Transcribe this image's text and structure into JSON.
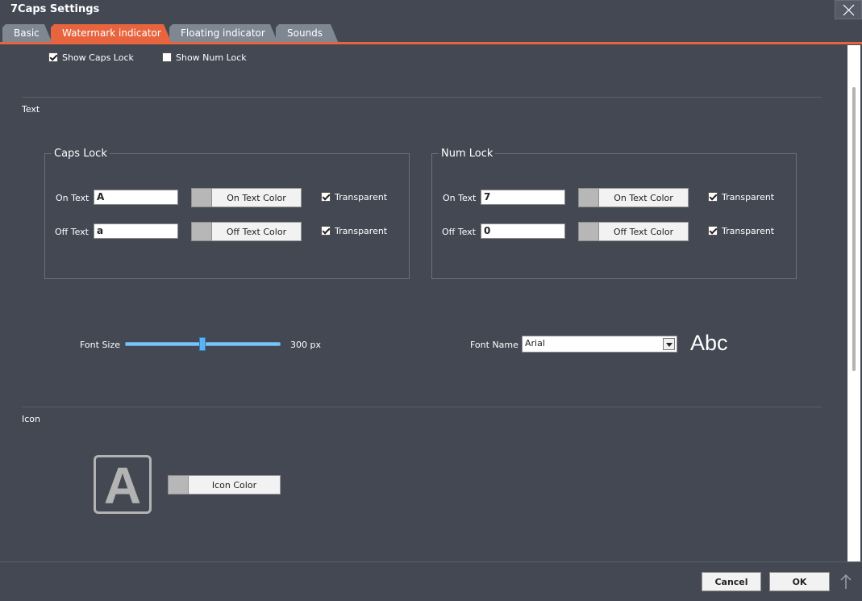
{
  "window": {
    "title": "7Caps Settings"
  },
  "tabs": [
    {
      "label": "Basic"
    },
    {
      "label": "Watermark indicator"
    },
    {
      "label": "Floating indicator"
    },
    {
      "label": "Sounds"
    }
  ],
  "top_options": {
    "show_caps_lock": {
      "label": "Show Caps Lock",
      "checked": true
    },
    "show_num_lock": {
      "label": "Show Num Lock",
      "checked": false
    }
  },
  "text_section": {
    "header": "Text",
    "caps_lock": {
      "title": "Caps Lock",
      "on_text_label": "On Text",
      "on_text_value": "A",
      "on_color_label": "On Text Color",
      "on_transparent_label": "Transparent",
      "off_text_label": "Off Text",
      "off_text_value": "a",
      "off_color_label": "Off Text Color",
      "off_transparent_label": "Transparent"
    },
    "num_lock": {
      "title": "Num Lock",
      "on_text_label": "On Text",
      "on_text_value": "7",
      "on_color_label": "On Text Color",
      "on_transparent_label": "Transparent",
      "off_text_label": "Off Text",
      "off_text_value": "0",
      "off_color_label": "Off Text Color",
      "off_transparent_label": "Transparent"
    },
    "font_size_label": "Font Size",
    "font_size_value": "300 px",
    "font_size_slider_fraction": 0.49,
    "font_name_label": "Font Name",
    "font_name_value": "Arial",
    "font_preview": "Abc"
  },
  "icon_section": {
    "header": "Icon",
    "icon_letter": "A",
    "icon_color_label": "Icon Color"
  },
  "footer": {
    "cancel_label": "Cancel",
    "ok_label": "OK"
  },
  "colors": {
    "accent": "#e8643e",
    "background": "#434853",
    "tab_inactive": "#7f8793",
    "swatch": "#b7b7b7"
  }
}
